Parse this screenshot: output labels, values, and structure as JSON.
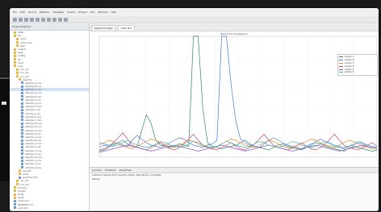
{
  "menu": [
    "File",
    "Edit",
    "Source",
    "Refactor",
    "Navigate",
    "Search",
    "Project",
    "Run",
    "Window",
    "Help"
  ],
  "navigator": {
    "header": "Project Explorer",
    "items": [
      {
        "label": "data",
        "indent": 1,
        "type": "folder"
      },
      {
        "label": "src",
        "indent": 1,
        "type": "folder"
      },
      {
        "label": "main",
        "indent": 2,
        "type": "folder"
      },
      {
        "label": "resources",
        "indent": 2,
        "type": "folder"
      },
      {
        "label": "test",
        "indent": 2,
        "type": "folder"
      },
      {
        "label": "output",
        "indent": 1,
        "type": "folder"
      },
      {
        "label": "logs",
        "indent": 1,
        "type": "folder"
      },
      {
        "label": "config",
        "indent": 1,
        "type": "folder"
      },
      {
        "label": "lib",
        "indent": 1,
        "type": "folder"
      },
      {
        "label": "docs",
        "indent": 1,
        "type": "folder"
      },
      {
        "label": "runs",
        "indent": 1,
        "type": "folder"
      },
      {
        "label": "run_01",
        "indent": 2,
        "type": "folder"
      },
      {
        "label": "run_02",
        "indent": 2,
        "type": "folder"
      },
      {
        "label": "run_03",
        "indent": 2,
        "type": "folder"
      },
      {
        "label": "spectra",
        "indent": 3,
        "type": "folder"
      },
      {
        "label": "sample_A.csv",
        "indent": 4,
        "type": "file"
      },
      {
        "label": "sample_B.csv",
        "indent": 4,
        "type": "file"
      },
      {
        "label": "sample_C.csv",
        "indent": 4,
        "type": "file"
      },
      {
        "label": "sample_D.csv",
        "indent": 4,
        "type": "file"
      },
      {
        "label": "sample_E.csv",
        "indent": 4,
        "type": "file"
      },
      {
        "label": "sample_F.csv",
        "indent": 4,
        "type": "file"
      },
      {
        "label": "sample_G.csv",
        "indent": 4,
        "type": "file"
      },
      {
        "label": "sample_H.csv",
        "indent": 4,
        "type": "file"
      },
      {
        "label": "sample_I.csv",
        "indent": 4,
        "type": "file"
      },
      {
        "label": "sample_J.csv",
        "indent": 4,
        "type": "file"
      },
      {
        "label": "sample_K.csv",
        "indent": 4,
        "type": "file"
      },
      {
        "label": "sample_L.csv",
        "indent": 4,
        "type": "file"
      },
      {
        "label": "sample_M.csv",
        "indent": 4,
        "type": "file"
      },
      {
        "label": "sample_N.csv",
        "indent": 4,
        "type": "file"
      },
      {
        "label": "sample_O.csv",
        "indent": 4,
        "type": "file"
      },
      {
        "label": "sample_P.csv",
        "indent": 4,
        "type": "file"
      },
      {
        "label": "sample_Q.csv",
        "indent": 4,
        "type": "file"
      },
      {
        "label": "sample_R.csv",
        "indent": 4,
        "type": "file"
      },
      {
        "label": "sample_S.csv",
        "indent": 4,
        "type": "file"
      },
      {
        "label": "sample_T.csv",
        "indent": 4,
        "type": "file"
      },
      {
        "label": "sample_U.csv",
        "indent": 4,
        "type": "file"
      },
      {
        "label": "sample_V.csv",
        "indent": 4,
        "type": "file"
      },
      {
        "label": "sample_W.csv",
        "indent": 4,
        "type": "file"
      },
      {
        "label": "sample_X.csv",
        "indent": 4,
        "type": "file"
      },
      {
        "label": "sample_Y.csv",
        "indent": 4,
        "type": "file"
      },
      {
        "label": "sample_Z.csv",
        "indent": 4,
        "type": "file"
      },
      {
        "label": "reports",
        "indent": 3,
        "type": "folder"
      },
      {
        "label": "plots",
        "indent": 3,
        "type": "folder"
      },
      {
        "label": "summary.txt",
        "indent": 3,
        "type": "file"
      },
      {
        "label": "run_04",
        "indent": 2,
        "type": "folder"
      },
      {
        "label": "run_05",
        "indent": 2,
        "type": "folder"
      },
      {
        "label": "archive",
        "indent": 1,
        "type": "folder"
      },
      {
        "label": "scripts",
        "indent": 1,
        "type": "folder"
      },
      {
        "label": "tools",
        "indent": 1,
        "type": "folder"
      },
      {
        "label": "temp",
        "indent": 1,
        "type": "folder"
      },
      {
        "label": "build.xml",
        "indent": 1,
        "type": "file"
      },
      {
        "label": "README.md",
        "indent": 1,
        "type": "file"
      },
      {
        "label": "pom.xml",
        "indent": 1,
        "type": "file"
      }
    ]
  },
  "main": {
    "tabs": [
      "Spectrum View",
      "Data Plot"
    ],
    "chart_title": "Spectrum Comparison"
  },
  "bottom": {
    "tabs": [
      "Console",
      "Problems",
      "Properties"
    ],
    "lines": [
      "Loaded 6 series from spectra folder. Rendering complete.",
      "Ready."
    ]
  },
  "watermarks": [
    "科技",
    "科技",
    "科技"
  ],
  "colors": {
    "accent": "#3d7cd1",
    "series": [
      "#2e8b57",
      "#4a7bd0",
      "#e0852a",
      "#c04a6a",
      "#8e5bc9",
      "#3fb0b0"
    ]
  },
  "chart_data": {
    "type": "line",
    "title": "",
    "xlabel": "",
    "ylabel": "",
    "ylim": [
      0,
      100
    ],
    "x": [
      0,
      1,
      2,
      3,
      4,
      5,
      6,
      7,
      8,
      9,
      10,
      11,
      12,
      13,
      14,
      15,
      16,
      17,
      18,
      19,
      20,
      21,
      22,
      23,
      24,
      25,
      26,
      27,
      28,
      29,
      30,
      31,
      32,
      33,
      34,
      35,
      36,
      37,
      38,
      39,
      40,
      41,
      42,
      43,
      44,
      45,
      46,
      47,
      48,
      49,
      50,
      51,
      52,
      53,
      54,
      55,
      56,
      57,
      58,
      59
    ],
    "series": [
      {
        "name": "sample_A",
        "color": "#2e8b57",
        "values": [
          5,
          6,
          8,
          10,
          12,
          14,
          11,
          9,
          8,
          22,
          35,
          28,
          14,
          10,
          9,
          8,
          9,
          11,
          10,
          9,
          100,
          100,
          40,
          12,
          9,
          8,
          7,
          8,
          9,
          10,
          12,
          14,
          11,
          9,
          8,
          7,
          6,
          8,
          10,
          11,
          9,
          8,
          7,
          6,
          8,
          10,
          12,
          11,
          9,
          8,
          7,
          6,
          5,
          7,
          9,
          8,
          7,
          6,
          5,
          6
        ]
      },
      {
        "name": "sample_B",
        "color": "#4a7bd0",
        "values": [
          8,
          10,
          9,
          11,
          12,
          10,
          9,
          14,
          18,
          15,
          12,
          10,
          9,
          8,
          10,
          12,
          14,
          16,
          15,
          12,
          10,
          9,
          8,
          10,
          11,
          14,
          100,
          100,
          60,
          30,
          15,
          12,
          10,
          9,
          8,
          11,
          14,
          16,
          14,
          12,
          10,
          9,
          8,
          7,
          9,
          11,
          13,
          15,
          13,
          11,
          9,
          8,
          7,
          9,
          10,
          12,
          11,
          9,
          8,
          7
        ]
      },
      {
        "name": "sample_C",
        "color": "#e0852a",
        "values": [
          10,
          12,
          14,
          13,
          11,
          9,
          8,
          7,
          9,
          11,
          13,
          15,
          14,
          12,
          10,
          9,
          8,
          10,
          12,
          14,
          13,
          11,
          9,
          8,
          7,
          9,
          11,
          13,
          15,
          14,
          12,
          10,
          9,
          8,
          10,
          12,
          14,
          13,
          11,
          9,
          8,
          7,
          9,
          11,
          13,
          15,
          14,
          12,
          10,
          9,
          8,
          10,
          12,
          14,
          13,
          11,
          9,
          8,
          7,
          9
        ]
      },
      {
        "name": "sample_D",
        "color": "#c04a6a",
        "values": [
          6,
          7,
          9,
          12,
          16,
          20,
          15,
          10,
          8,
          7,
          6,
          8,
          10,
          12,
          9,
          7,
          6,
          8,
          11,
          15,
          19,
          14,
          10,
          8,
          7,
          6,
          8,
          10,
          12,
          9,
          7,
          6,
          8,
          11,
          15,
          19,
          14,
          10,
          8,
          7,
          6,
          8,
          10,
          12,
          9,
          7,
          6,
          8,
          11,
          15,
          19,
          14,
          10,
          8,
          7,
          6,
          8,
          10,
          12,
          9
        ]
      },
      {
        "name": "sample_E",
        "color": "#8e5bc9",
        "values": [
          4,
          5,
          6,
          7,
          8,
          9,
          10,
          9,
          8,
          7,
          6,
          5,
          6,
          7,
          8,
          9,
          10,
          9,
          8,
          7,
          6,
          5,
          6,
          7,
          8,
          9,
          10,
          9,
          8,
          7,
          6,
          5,
          6,
          7,
          8,
          9,
          10,
          9,
          8,
          7,
          6,
          5,
          6,
          7,
          8,
          9,
          10,
          9,
          8,
          7,
          6,
          5,
          6,
          7,
          8,
          9,
          10,
          9,
          8,
          7
        ]
      },
      {
        "name": "sample_F",
        "color": "#3fb0b0",
        "values": [
          12,
          11,
          10,
          9,
          10,
          12,
          14,
          12,
          10,
          9,
          8,
          9,
          11,
          13,
          12,
          10,
          9,
          8,
          9,
          11,
          13,
          12,
          10,
          9,
          8,
          9,
          11,
          13,
          12,
          10,
          9,
          8,
          9,
          11,
          13,
          12,
          10,
          9,
          8,
          9,
          11,
          13,
          12,
          10,
          9,
          8,
          9,
          11,
          13,
          12,
          10,
          9,
          8,
          9,
          11,
          13,
          12,
          10,
          9,
          8
        ]
      }
    ]
  }
}
